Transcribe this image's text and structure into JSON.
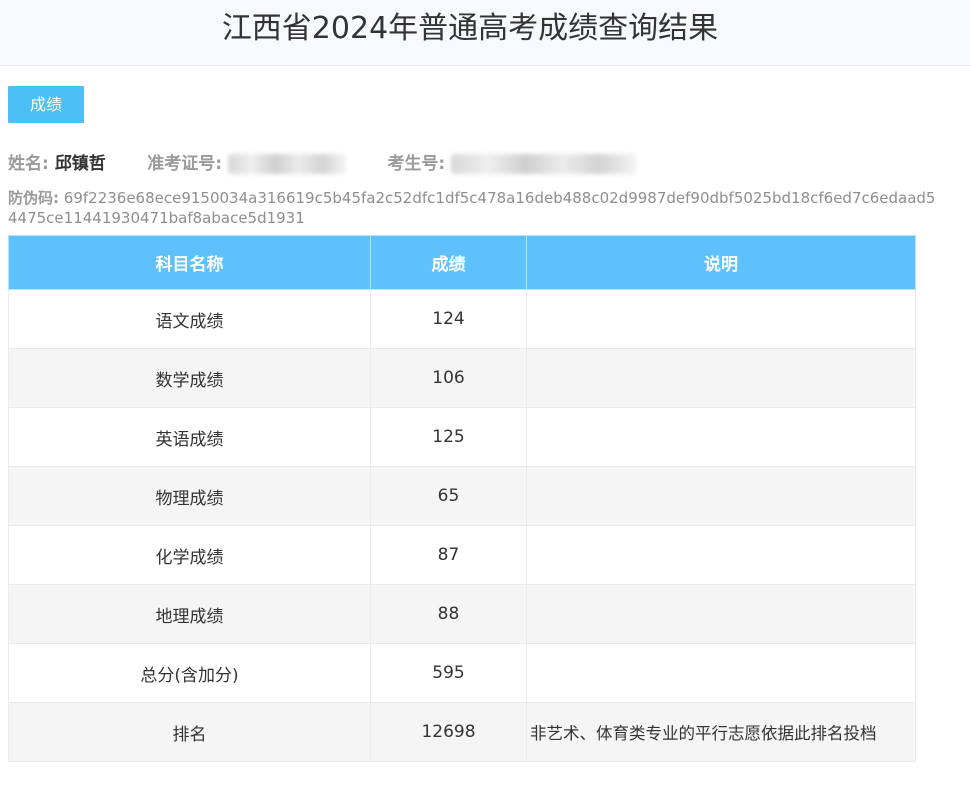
{
  "page": {
    "title": "江西省2024年普通高考成绩查询结果"
  },
  "tab": {
    "label": "成绩"
  },
  "student": {
    "name_label": "姓名:",
    "name": "邱镇哲",
    "exam_id_label": "准考证号:",
    "candidate_no_label": "考生号:"
  },
  "anti_fake": {
    "label": "防伪码:",
    "code": "69f2236e68ece9150034a316619c5b45fa2c52dfc1df5c478a16deb488c02d9987def90dbf5025bd18cf6ed7c6edaad54475ce11441930471baf8abace5d1931"
  },
  "table": {
    "headers": [
      "科目名称",
      "成绩",
      "说明"
    ],
    "rows": [
      {
        "subject": "语文成绩",
        "score": "124",
        "note": ""
      },
      {
        "subject": "数学成绩",
        "score": "106",
        "note": ""
      },
      {
        "subject": "英语成绩",
        "score": "125",
        "note": ""
      },
      {
        "subject": "物理成绩",
        "score": "65",
        "note": ""
      },
      {
        "subject": "化学成绩",
        "score": "87",
        "note": ""
      },
      {
        "subject": "地理成绩",
        "score": "88",
        "note": ""
      },
      {
        "subject": "总分(含加分)",
        "score": "595",
        "note": ""
      },
      {
        "subject": "排名",
        "score": "12698",
        "note": "非艺术、体育类专业的平行志愿依据此排名投档"
      }
    ]
  },
  "colors": {
    "accent": "#4cc0f5",
    "table_header": "#5ec1fb",
    "row_alt": "#f5f5f5",
    "header_bg": "#f7f9fe"
  }
}
